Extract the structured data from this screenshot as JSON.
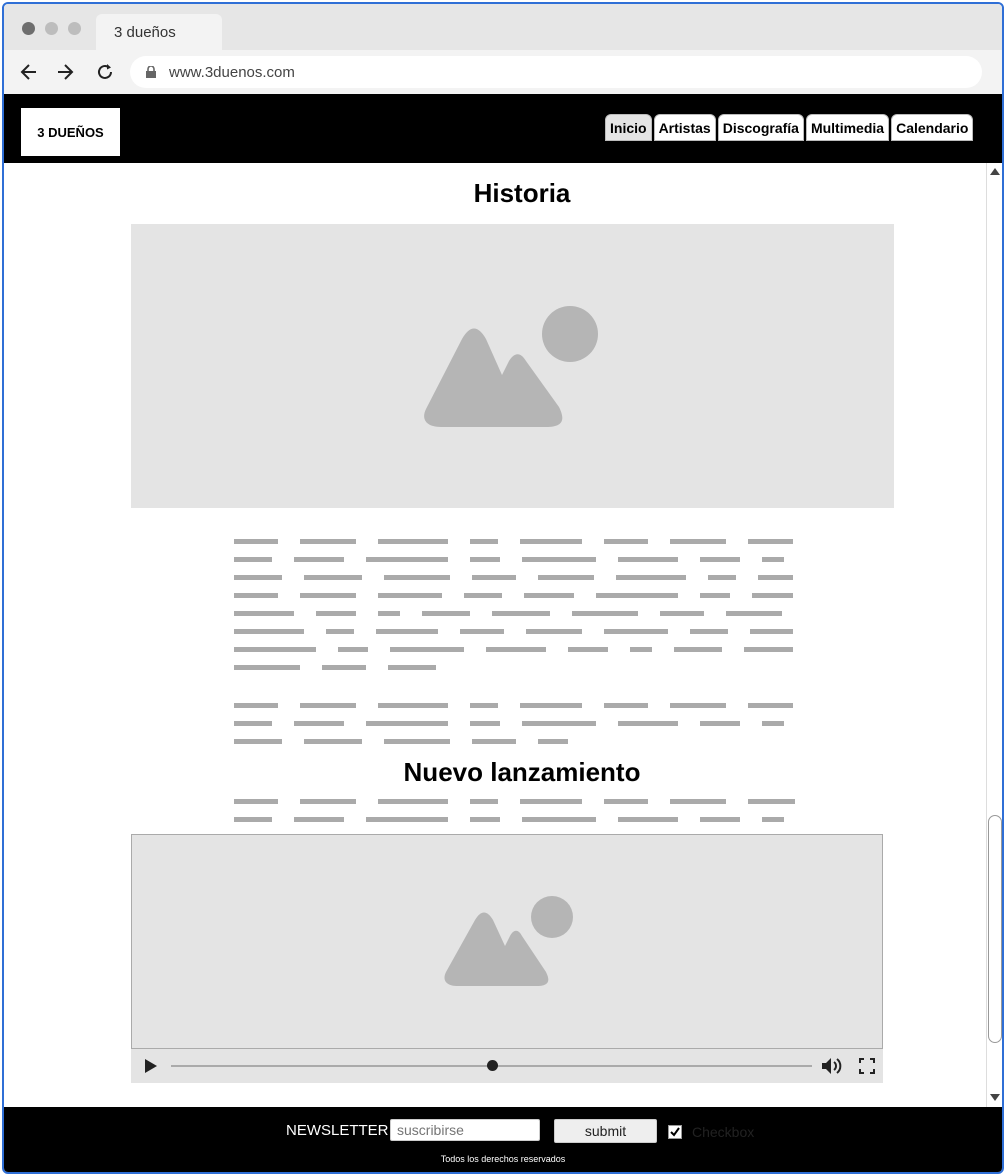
{
  "browser": {
    "tab_title": "3 dueños",
    "url": "www.3duenos.com",
    "colors": {
      "frame": "#2f6fd6",
      "chrome": "#e6e6e6"
    }
  },
  "site": {
    "logo": "3 DUEÑOS",
    "nav": [
      "Inicio",
      "Artistas",
      "Discografía",
      "Multimedia",
      "Calendario"
    ],
    "active_nav": "Inicio"
  },
  "main": {
    "section1_title": "Historia",
    "section2_title": "Nuevo lanzamiento",
    "video": {
      "progress": 0.5
    }
  },
  "footer": {
    "newsletter_label": "NEWSLETTER",
    "newsletter_placeholder": "suscribirse",
    "submit_label": "submit",
    "checkbox_label": "Checkbox",
    "checkbox_checked": true,
    "rights": "Todos los derechos reservados"
  },
  "icons": {
    "back": "arrow-left-icon",
    "forward": "arrow-right-icon",
    "reload": "reload-icon",
    "lock": "lock-icon",
    "image": "image-placeholder-icon",
    "play": "play-icon",
    "volume": "volume-icon",
    "fullscreen": "fullscreen-icon"
  }
}
